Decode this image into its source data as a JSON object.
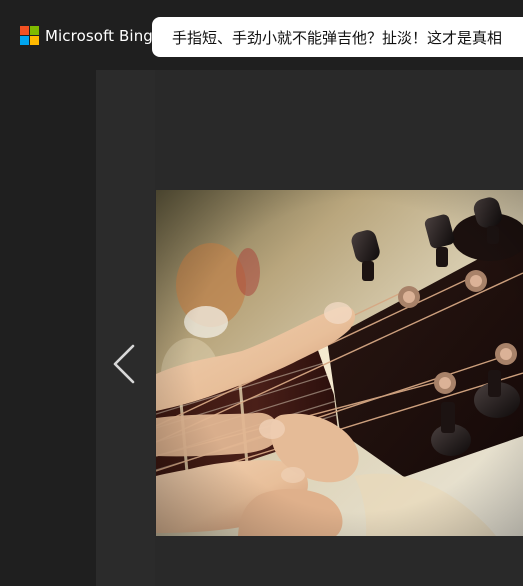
{
  "header": {
    "brand": {
      "name": "Microsoft Bing",
      "logo": "microsoft-logo",
      "colors": {
        "red": "#f25022",
        "green": "#7fba00",
        "blue": "#00a4ef",
        "yellow": "#ffb900"
      }
    },
    "query": "手指短、手劲小就不能弹吉他？扯淡！这才是真相"
  },
  "viewer": {
    "prev_icon": "chevron-left-icon",
    "image": {
      "subject": "guitar-headstock-and-hand-photo"
    }
  },
  "theme": {
    "page_bg": "#1f1f1f",
    "viewer_bg": "#292929",
    "strip_bg": "#2b2b2b",
    "pill_bg": "#ffffff"
  }
}
